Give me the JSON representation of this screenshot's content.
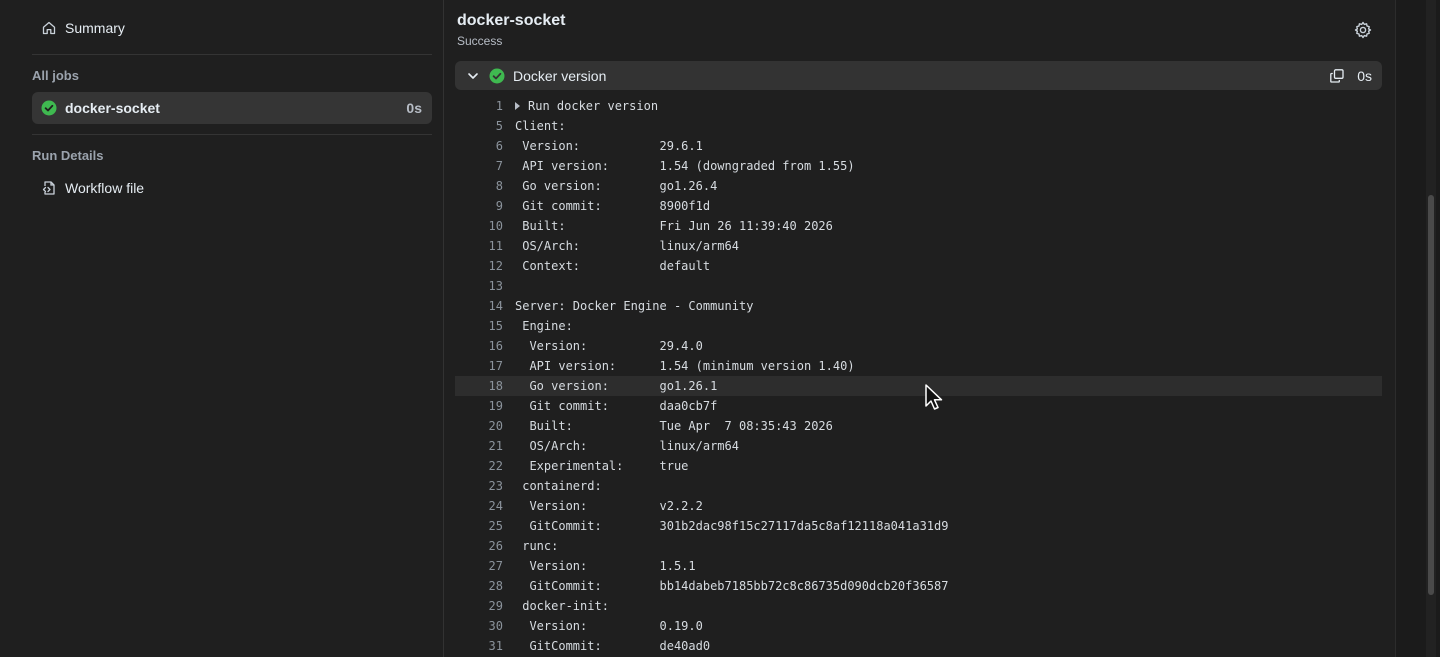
{
  "sidebar": {
    "summary_label": "Summary",
    "all_jobs_heading": "All jobs",
    "jobs": [
      {
        "name": "docker-socket",
        "duration": "0s",
        "status": "success"
      }
    ],
    "run_details_heading": "Run Details",
    "workflow_file_label": "Workflow file"
  },
  "job": {
    "title": "docker-socket",
    "status": "Success"
  },
  "step": {
    "name": "Docker version",
    "duration": "0s"
  },
  "log_lines": [
    {
      "n": "1",
      "text": "Run docker version",
      "collapsed": true
    },
    {
      "n": "5",
      "text": "Client:"
    },
    {
      "n": "6",
      "text": " Version:           29.6.1"
    },
    {
      "n": "7",
      "text": " API version:       1.54 (downgraded from 1.55)"
    },
    {
      "n": "8",
      "text": " Go version:        go1.26.4"
    },
    {
      "n": "9",
      "text": " Git commit:        8900f1d"
    },
    {
      "n": "10",
      "text": " Built:             Fri Jun 26 11:39:40 2026"
    },
    {
      "n": "11",
      "text": " OS/Arch:           linux/arm64"
    },
    {
      "n": "12",
      "text": " Context:           default"
    },
    {
      "n": "13",
      "text": ""
    },
    {
      "n": "14",
      "text": "Server: Docker Engine - Community"
    },
    {
      "n": "15",
      "text": " Engine:"
    },
    {
      "n": "16",
      "text": "  Version:          29.4.0"
    },
    {
      "n": "17",
      "text": "  API version:      1.54 (minimum version 1.40)"
    },
    {
      "n": "18",
      "text": "  Go version:       go1.26.1",
      "highlighted": true
    },
    {
      "n": "19",
      "text": "  Git commit:       daa0cb7f"
    },
    {
      "n": "20",
      "text": "  Built:            Tue Apr  7 08:35:43 2026"
    },
    {
      "n": "21",
      "text": "  OS/Arch:          linux/arm64"
    },
    {
      "n": "22",
      "text": "  Experimental:     true"
    },
    {
      "n": "23",
      "text": " containerd:"
    },
    {
      "n": "24",
      "text": "  Version:          v2.2.2"
    },
    {
      "n": "25",
      "text": "  GitCommit:        301b2dac98f15c27117da5c8af12118a041a31d9"
    },
    {
      "n": "26",
      "text": " runc:"
    },
    {
      "n": "27",
      "text": "  Version:          1.5.1"
    },
    {
      "n": "28",
      "text": "  GitCommit:        bb14dabeb7185bb72c8c86735d090dcb20f36587"
    },
    {
      "n": "29",
      "text": " docker-init:"
    },
    {
      "n": "30",
      "text": "  Version:          0.19.0"
    },
    {
      "n": "31",
      "text": "  GitCommit:        de40ad0"
    }
  ],
  "colors": {
    "success": "#3fb950",
    "background": "#1f1f1f",
    "step_header_bg": "#333333"
  }
}
